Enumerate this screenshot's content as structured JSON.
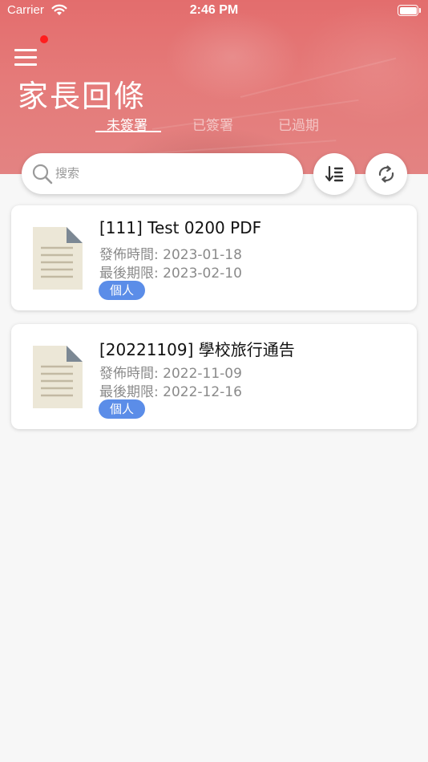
{
  "status_bar": {
    "carrier": "Carrier",
    "time": "2:46 PM"
  },
  "header": {
    "title": "家長回條",
    "tabs": [
      {
        "label": "未簽署",
        "active": true
      },
      {
        "label": "已簽署",
        "active": false
      },
      {
        "label": "已過期",
        "active": false
      }
    ]
  },
  "search": {
    "placeholder": "搜索",
    "value": ""
  },
  "actions": {
    "sort_icon": "sort-icon",
    "refresh_icon": "refresh-icon"
  },
  "notices": [
    {
      "title": "[111] Test 0200 PDF",
      "published": "發佈時間: 2023-01-18",
      "deadline": "最後期限: 2023-02-10",
      "tag": "個人"
    },
    {
      "title": "[20221109] 學校旅行通告",
      "published": "發佈時間: 2022-11-09",
      "deadline": "最後期限: 2022-12-16",
      "tag": "個人"
    }
  ],
  "colors": {
    "header": "#e57a79",
    "tag": "#5b8de8",
    "notification_dot": "#ff1d1d",
    "background": "#f7f7f7"
  }
}
